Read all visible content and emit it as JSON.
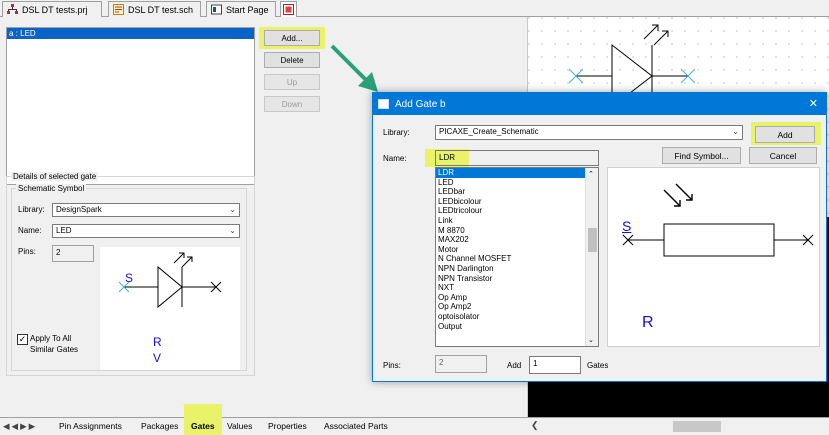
{
  "doc_tabs": [
    {
      "label": "DSL DT tests.prj",
      "icon": "project-icon"
    },
    {
      "label": "DSL DT test.sch",
      "icon": "schematic-icon"
    },
    {
      "label": "Start Page",
      "icon": "start-page-icon"
    },
    {
      "label": "",
      "icon": "component-editor-icon"
    }
  ],
  "gates": {
    "items": [
      "a : LED"
    ],
    "selected_index": 0
  },
  "gate_buttons": {
    "add": "Add...",
    "delete": "Delete",
    "up": "Up",
    "down": "Down"
  },
  "details": {
    "group_title": "Details of selected gate",
    "schematic_title": "Schematic Symbol",
    "library_label": "Library:",
    "library_value": "DesignSpark",
    "name_label": "Name:",
    "name_value": "LED",
    "pins_label": "Pins:",
    "pins_value": "2",
    "apply_all_label_1": "Apply To All",
    "apply_all_label_2": "Similar Gates",
    "apply_all_checked": true,
    "symbol_pin_label": "S",
    "symbol_ref_label": "R",
    "symbol_value_label": "V"
  },
  "bottom_tabs": [
    "Pin Assignments",
    "Packages",
    "Gates",
    "Values",
    "Properties",
    "Associated Parts"
  ],
  "bottom_tabs_active": "Gates",
  "dialog": {
    "title": "Add Gate b",
    "close_glyph": "✕",
    "library_label": "Library:",
    "library_value": "PICAXE_Create_Schematic",
    "name_label": "Name:",
    "name_value": "LDR",
    "add_button": "Add",
    "find_symbol_button": "Find Symbol...",
    "cancel_button": "Cancel",
    "symbol_list": [
      "LDR",
      "LED",
      "LEDbar",
      "LEDbicolour",
      "LEDtricolour",
      "Link",
      "M 8870",
      "MAX202",
      "Motor",
      "N Channel MOSFET",
      "NPN Darlington",
      "NPN Transistor",
      "NXT",
      "Op Amp",
      "Op Amp2",
      "optoisolator",
      "Output"
    ],
    "selected_symbol": "LDR",
    "pins_label": "Pins:",
    "pins_value": "2",
    "add_count_label": "Add",
    "add_count_value": "1",
    "gates_label": "Gates",
    "preview_pin_label": "S",
    "preview_ref_label": "R"
  },
  "colors": {
    "selection": "#0a64c8",
    "dialog_titlebar": "#0078d7",
    "highlight": "#e8f36a",
    "callout_arrow": "#2aa07a",
    "symbol_blue": "#1010e0",
    "pin_cross": "#4ab0d0"
  }
}
